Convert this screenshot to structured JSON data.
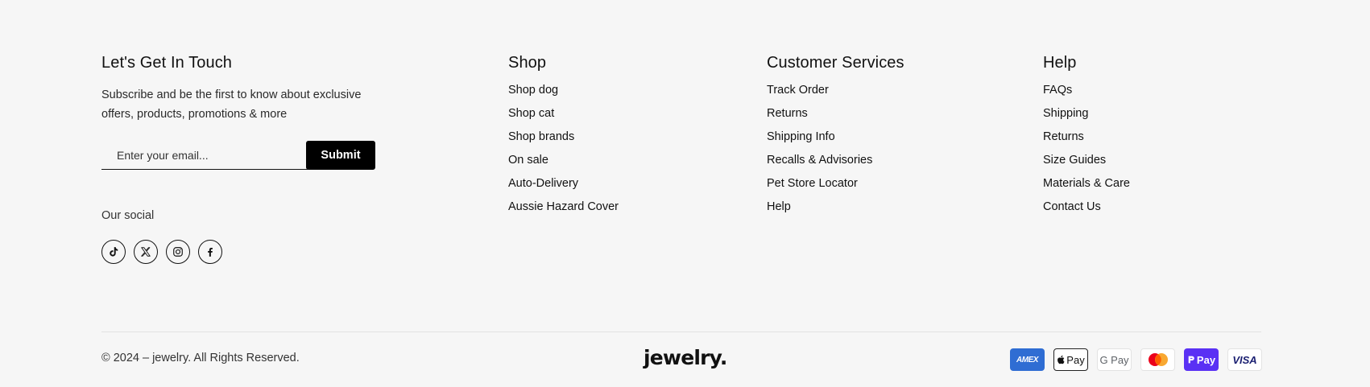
{
  "touch": {
    "title": "Let's Get In Touch",
    "subscribe_text": "Subscribe and be the first to know about exclusive offers, products, promotions & more",
    "email_placeholder": "Enter your email...",
    "submit_label": "Submit",
    "social_label": "Our social",
    "social_icons": [
      "tiktok-icon",
      "x-icon",
      "instagram-icon",
      "facebook-icon"
    ]
  },
  "shop": {
    "title": "Shop",
    "links": [
      "Shop dog",
      "Shop cat",
      "Shop brands",
      "On sale",
      "Auto-Delivery",
      "Aussie Hazard Cover"
    ]
  },
  "customer_services": {
    "title": "Customer Services",
    "links": [
      "Track Order",
      "Returns",
      "Shipping Info",
      "Recalls & Advisories",
      "Pet Store Locator",
      "Help"
    ]
  },
  "help": {
    "title": "Help",
    "links": [
      "FAQs",
      "Shipping",
      "Returns",
      "Size Guides",
      "Materials & Care",
      "Contact Us"
    ]
  },
  "bottom": {
    "copyright": "© 2024 – jewelry. All Rights Reserved.",
    "logo": "jewelry.",
    "payments": {
      "amex": "AMEX",
      "apple_pay": "Pay",
      "google_pay": "G Pay",
      "shop_pay": "Pay",
      "visa": "VISA"
    }
  },
  "colors": {
    "background": "#f6f6f6",
    "button": "#000000",
    "amex": "#2f6dd3",
    "shop_pay": "#5a31f4",
    "mastercard_red": "#eb001b",
    "mastercard_orange": "#f79e1b"
  }
}
